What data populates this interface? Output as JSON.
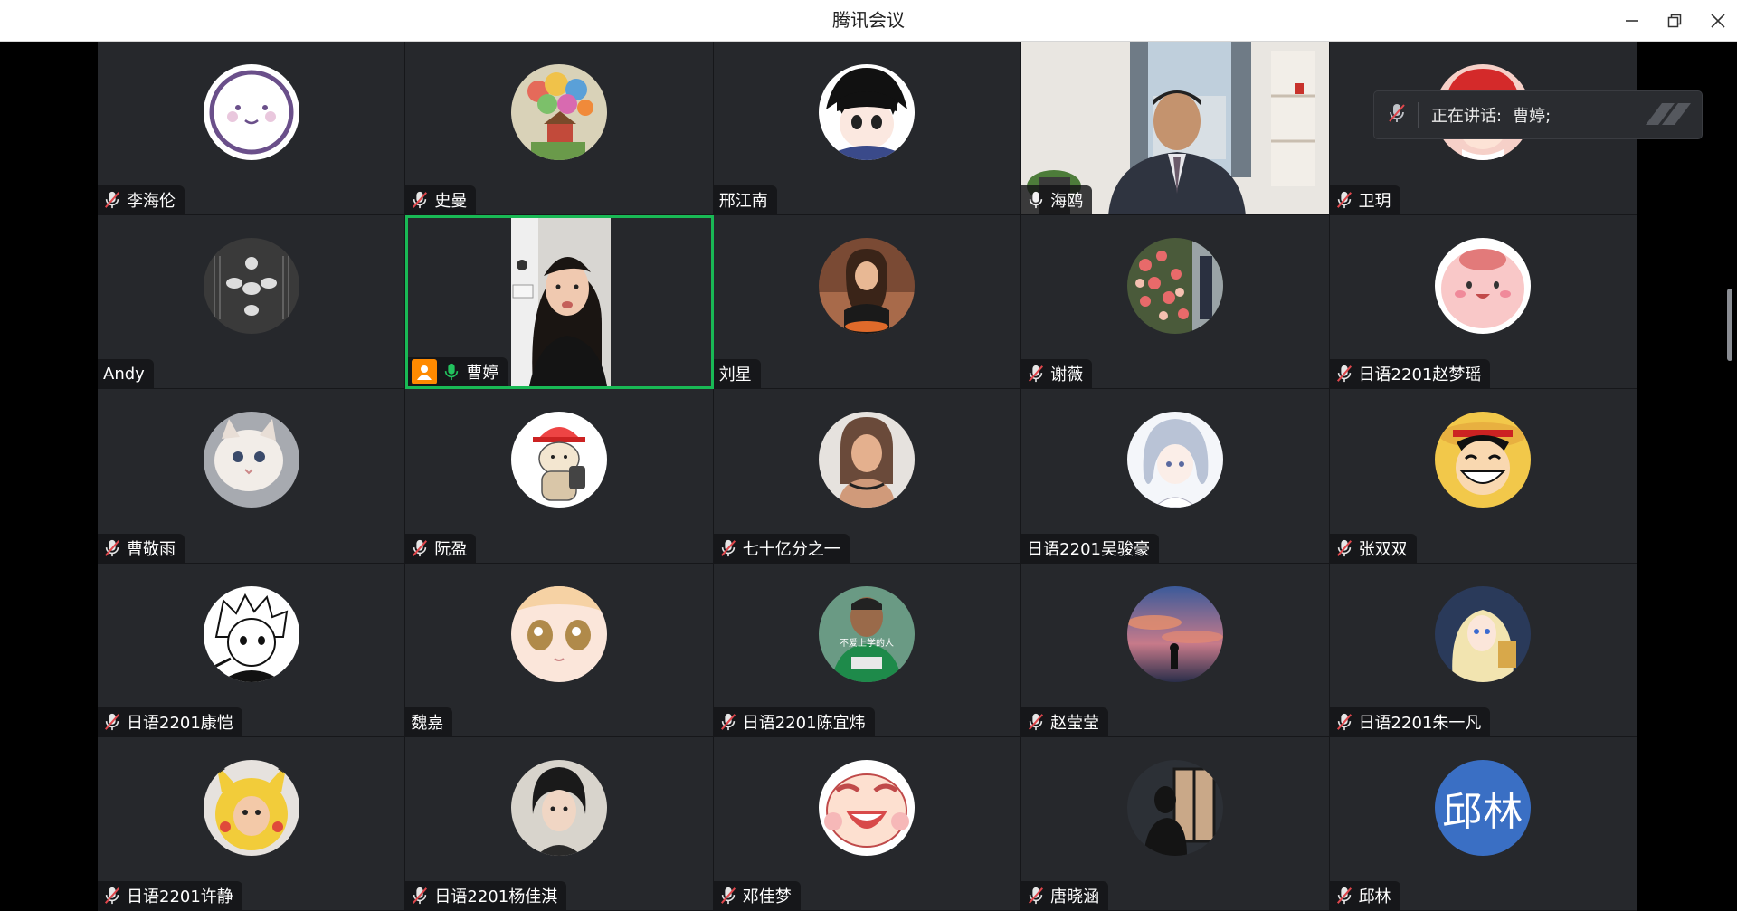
{
  "window": {
    "title": "腾讯会议",
    "controls": [
      "minimize-icon",
      "restore-icon",
      "close-icon"
    ]
  },
  "colors": {
    "tile_bg": "#26282c",
    "speaking_border": "#19b955",
    "badge_orange": "#ff8a00",
    "text_avatar_blue": "#3a6fc4"
  },
  "speaking_toast": {
    "label": "正在讲话:",
    "speakers": "曹婷;",
    "icon": "mic-muted-icon"
  },
  "participants": [
    {
      "name": "李海伦",
      "mic": "muted",
      "avatar": "cute-face"
    },
    {
      "name": "史曼",
      "mic": "muted",
      "avatar": "balloon-house"
    },
    {
      "name": "邢江南",
      "mic": "none",
      "avatar": "anime-boy"
    },
    {
      "name": "海鸥",
      "mic": "on",
      "avatar": "camera-video"
    },
    {
      "name": "卫玥",
      "mic": "muted",
      "avatar": "red-hair-girl"
    },
    {
      "name": "Andy",
      "mic": "none",
      "avatar": "ink-drawing"
    },
    {
      "name": "曹婷",
      "mic": "active",
      "avatar": "camera-video",
      "speaking": true
    },
    {
      "name": "刘星",
      "mic": "none",
      "avatar": "girl-photo"
    },
    {
      "name": "谢薇",
      "mic": "muted",
      "avatar": "flowers"
    },
    {
      "name": "日语2201赵梦瑶",
      "mic": "muted",
      "avatar": "pink-blob"
    },
    {
      "name": "曹敬雨",
      "mic": "muted",
      "avatar": "cat"
    },
    {
      "name": "阮盈",
      "mic": "muted",
      "avatar": "cat-cap"
    },
    {
      "name": "七十亿分之一",
      "mic": "muted",
      "avatar": "woman-portrait"
    },
    {
      "name": "日语2201吴骏豪",
      "mic": "none",
      "avatar": "anime-girl-blue"
    },
    {
      "name": "张双双",
      "mic": "muted",
      "avatar": "luffy"
    },
    {
      "name": "日语2201康恺",
      "mic": "muted",
      "avatar": "manga-boy"
    },
    {
      "name": "魏嘉",
      "mic": "none",
      "avatar": "anime-eyes"
    },
    {
      "name": "日语2201陈宜炜",
      "mic": "muted",
      "avatar": "man-photo",
      "avatar_caption": "不爱上学的人"
    },
    {
      "name": "赵莹莹",
      "mic": "muted",
      "avatar": "sunset-sky"
    },
    {
      "name": "日语2201朱一凡",
      "mic": "muted",
      "avatar": "blonde-anime"
    },
    {
      "name": "日语2201许静",
      "mic": "muted",
      "avatar": "pikachu-costume"
    },
    {
      "name": "日语2201杨佳淇",
      "mic": "muted",
      "avatar": "kpop-portrait"
    },
    {
      "name": "邓佳梦",
      "mic": "muted",
      "avatar": "crying-cartoon"
    },
    {
      "name": "唐晓涵",
      "mic": "muted",
      "avatar": "window-silhouette"
    },
    {
      "name": "邱林",
      "mic": "muted",
      "avatar": "text",
      "avatar_text": "邱林"
    }
  ]
}
